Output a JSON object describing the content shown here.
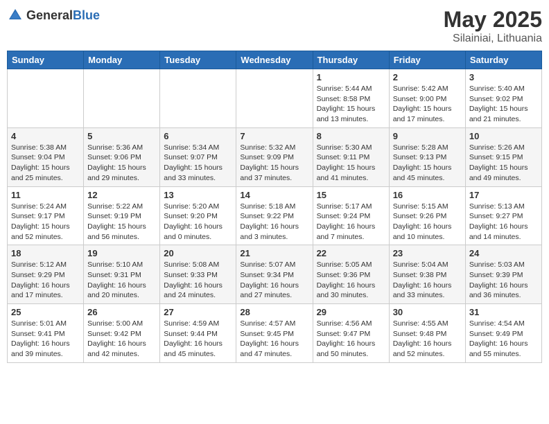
{
  "header": {
    "logo_general": "General",
    "logo_blue": "Blue",
    "title": "May 2025",
    "subtitle": "Silainiai, Lithuania"
  },
  "weekdays": [
    "Sunday",
    "Monday",
    "Tuesday",
    "Wednesday",
    "Thursday",
    "Friday",
    "Saturday"
  ],
  "weeks": [
    [
      {
        "day": "",
        "info": ""
      },
      {
        "day": "",
        "info": ""
      },
      {
        "day": "",
        "info": ""
      },
      {
        "day": "",
        "info": ""
      },
      {
        "day": "1",
        "info": "Sunrise: 5:44 AM\nSunset: 8:58 PM\nDaylight: 15 hours\nand 13 minutes."
      },
      {
        "day": "2",
        "info": "Sunrise: 5:42 AM\nSunset: 9:00 PM\nDaylight: 15 hours\nand 17 minutes."
      },
      {
        "day": "3",
        "info": "Sunrise: 5:40 AM\nSunset: 9:02 PM\nDaylight: 15 hours\nand 21 minutes."
      }
    ],
    [
      {
        "day": "4",
        "info": "Sunrise: 5:38 AM\nSunset: 9:04 PM\nDaylight: 15 hours\nand 25 minutes."
      },
      {
        "day": "5",
        "info": "Sunrise: 5:36 AM\nSunset: 9:06 PM\nDaylight: 15 hours\nand 29 minutes."
      },
      {
        "day": "6",
        "info": "Sunrise: 5:34 AM\nSunset: 9:07 PM\nDaylight: 15 hours\nand 33 minutes."
      },
      {
        "day": "7",
        "info": "Sunrise: 5:32 AM\nSunset: 9:09 PM\nDaylight: 15 hours\nand 37 minutes."
      },
      {
        "day": "8",
        "info": "Sunrise: 5:30 AM\nSunset: 9:11 PM\nDaylight: 15 hours\nand 41 minutes."
      },
      {
        "day": "9",
        "info": "Sunrise: 5:28 AM\nSunset: 9:13 PM\nDaylight: 15 hours\nand 45 minutes."
      },
      {
        "day": "10",
        "info": "Sunrise: 5:26 AM\nSunset: 9:15 PM\nDaylight: 15 hours\nand 49 minutes."
      }
    ],
    [
      {
        "day": "11",
        "info": "Sunrise: 5:24 AM\nSunset: 9:17 PM\nDaylight: 15 hours\nand 52 minutes."
      },
      {
        "day": "12",
        "info": "Sunrise: 5:22 AM\nSunset: 9:19 PM\nDaylight: 15 hours\nand 56 minutes."
      },
      {
        "day": "13",
        "info": "Sunrise: 5:20 AM\nSunset: 9:20 PM\nDaylight: 16 hours\nand 0 minutes."
      },
      {
        "day": "14",
        "info": "Sunrise: 5:18 AM\nSunset: 9:22 PM\nDaylight: 16 hours\nand 3 minutes."
      },
      {
        "day": "15",
        "info": "Sunrise: 5:17 AM\nSunset: 9:24 PM\nDaylight: 16 hours\nand 7 minutes."
      },
      {
        "day": "16",
        "info": "Sunrise: 5:15 AM\nSunset: 9:26 PM\nDaylight: 16 hours\nand 10 minutes."
      },
      {
        "day": "17",
        "info": "Sunrise: 5:13 AM\nSunset: 9:27 PM\nDaylight: 16 hours\nand 14 minutes."
      }
    ],
    [
      {
        "day": "18",
        "info": "Sunrise: 5:12 AM\nSunset: 9:29 PM\nDaylight: 16 hours\nand 17 minutes."
      },
      {
        "day": "19",
        "info": "Sunrise: 5:10 AM\nSunset: 9:31 PM\nDaylight: 16 hours\nand 20 minutes."
      },
      {
        "day": "20",
        "info": "Sunrise: 5:08 AM\nSunset: 9:33 PM\nDaylight: 16 hours\nand 24 minutes."
      },
      {
        "day": "21",
        "info": "Sunrise: 5:07 AM\nSunset: 9:34 PM\nDaylight: 16 hours\nand 27 minutes."
      },
      {
        "day": "22",
        "info": "Sunrise: 5:05 AM\nSunset: 9:36 PM\nDaylight: 16 hours\nand 30 minutes."
      },
      {
        "day": "23",
        "info": "Sunrise: 5:04 AM\nSunset: 9:38 PM\nDaylight: 16 hours\nand 33 minutes."
      },
      {
        "day": "24",
        "info": "Sunrise: 5:03 AM\nSunset: 9:39 PM\nDaylight: 16 hours\nand 36 minutes."
      }
    ],
    [
      {
        "day": "25",
        "info": "Sunrise: 5:01 AM\nSunset: 9:41 PM\nDaylight: 16 hours\nand 39 minutes."
      },
      {
        "day": "26",
        "info": "Sunrise: 5:00 AM\nSunset: 9:42 PM\nDaylight: 16 hours\nand 42 minutes."
      },
      {
        "day": "27",
        "info": "Sunrise: 4:59 AM\nSunset: 9:44 PM\nDaylight: 16 hours\nand 45 minutes."
      },
      {
        "day": "28",
        "info": "Sunrise: 4:57 AM\nSunset: 9:45 PM\nDaylight: 16 hours\nand 47 minutes."
      },
      {
        "day": "29",
        "info": "Sunrise: 4:56 AM\nSunset: 9:47 PM\nDaylight: 16 hours\nand 50 minutes."
      },
      {
        "day": "30",
        "info": "Sunrise: 4:55 AM\nSunset: 9:48 PM\nDaylight: 16 hours\nand 52 minutes."
      },
      {
        "day": "31",
        "info": "Sunrise: 4:54 AM\nSunset: 9:49 PM\nDaylight: 16 hours\nand 55 minutes."
      }
    ]
  ]
}
